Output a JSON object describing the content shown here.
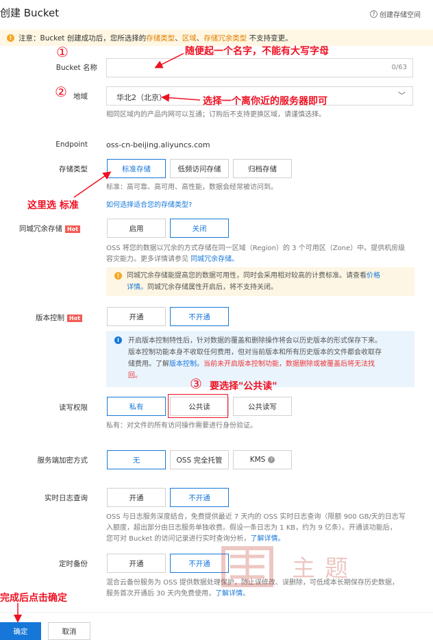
{
  "header": {
    "title": "创建 Bucket",
    "help_label": "创建存储空间",
    "help_icon": "question-circle-icon"
  },
  "notice": {
    "prefix": "注意：Bucket 创建成功后，您所选择的",
    "hl1": "存储类型",
    "sep1": "、",
    "hl2": "区域",
    "sep2": "、",
    "hl3": "存储冗余类型",
    "suffix": "不支持变更。"
  },
  "bucket_name": {
    "label": "Bucket 名称",
    "value": "",
    "counter": "0/63"
  },
  "region": {
    "label": "地域",
    "value": "华北2（北京）",
    "desc": "相同区域内的产品内网可以互通；订购后不支持更换区域，请谨慎选择。"
  },
  "endpoint": {
    "label": "Endpoint",
    "value": "oss-cn-beijing.aliyuncs.com"
  },
  "storage_class": {
    "label": "存储类型",
    "options": [
      "标准存储",
      "低频访问存储",
      "归档存储"
    ],
    "selected": "标准存储",
    "desc": "标准：高可靠、高可用、高性能，数据会经常被访问到。",
    "link": "如何选择适合您的存储类型?"
  },
  "redundancy": {
    "label": "同城冗余存储",
    "hot": "Hot",
    "options": [
      "启用",
      "关闭"
    ],
    "selected": "关闭",
    "desc_line1": "OSS 将您的数据以冗余的方式存储在同一区域（Region）的 3 个可用区（Zone）中。提供机房级",
    "desc_line2": "容灾能力。更多详情请参见",
    "desc_link": "同城冗余存储。",
    "warn_line1": "同城冗余存储能提高您的数据可用性，同时会采用相对较高的计费标准。请查看",
    "warn_link1": "价格",
    "warn_link2": "详情。",
    "warn_line2": "同城冗余存储属性开启后，将不支持关闭。"
  },
  "versioning": {
    "label": "版本控制",
    "hot": "Hot",
    "options": [
      "开通",
      "不开通"
    ],
    "selected": "不开通",
    "info_line1": "开启版本控制特性后，针对数据的覆盖和删除操作将会以历史版本的形式保存下来。",
    "info_line2": "版本控制功能本身不收取任何费用，但对当前版本和所有历史版本的文件都会收取存",
    "info_line3": "储费用。了解",
    "info_link": "版本控制。",
    "info_red1": "当前未开启版本控制功能，数据删除或被覆盖后将无法找",
    "info_red2": "回。"
  },
  "acl": {
    "label": "读写权限",
    "options": [
      "私有",
      "公共读",
      "公共读写"
    ],
    "selected": "私有",
    "desc": "私有：对文件的所有访问操作需要进行身份验证。"
  },
  "encryption": {
    "label": "服务端加密方式",
    "options": [
      "无",
      "OSS 完全托管",
      "KMS"
    ],
    "selected": "无"
  },
  "realtime_log": {
    "label": "实时日志查询",
    "options": [
      "开通",
      "不开通"
    ],
    "selected": "不开通",
    "desc_line1": "OSS 与日志服务深度结合，免费提供最近 7 天内的 OSS 实时日志查询（限额 900 GB/天的日志写",
    "desc_line2": "入额度，超出部分由日志服务单独收费。假设一条日志为 1 KB，约为 9 亿条）。开通该功能后，",
    "desc_line3": "您可对 Bucket 的访问记录进行实时查询分析，",
    "desc_link": "了解详情。"
  },
  "backup": {
    "label": "定时备份",
    "options": [
      "开通",
      "不开通"
    ],
    "selected": "不开通",
    "desc_line1": "混合云备份服务为 OSS 提供数据处理保护，防止误修改、误删除，可低成本长期保存历史数据，",
    "desc_line2": "服务首次开通后 30 天内免费使用，",
    "desc_link": "了解详情。"
  },
  "footer": {
    "ok": "确定",
    "cancel": "取消"
  },
  "annotations": {
    "n1": "①",
    "a1": "随便起一个名字，不能有大写字母",
    "n2": "②",
    "a2": "选择一个离你近的服务器即可",
    "a_std": "这里选 标准",
    "n3": "③",
    "a3": "要选择\"公共读\"",
    "a_done": "完成后点击确定"
  },
  "watermark": {
    "text": "主题"
  },
  "colors": {
    "primary": "#1677d8",
    "annotation": "#ee1122",
    "warning": "#f5a623",
    "hot": "#f25c54"
  }
}
